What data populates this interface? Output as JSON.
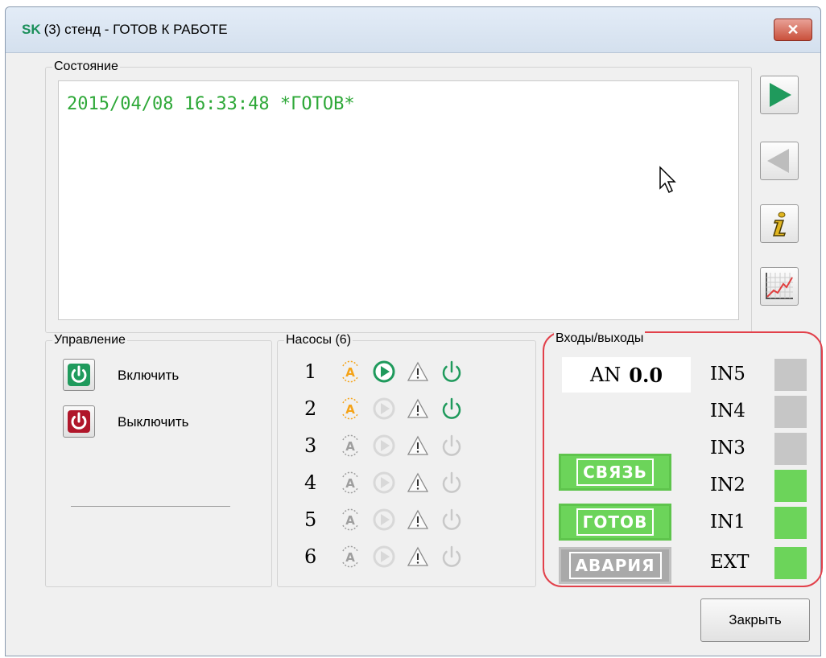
{
  "window": {
    "brand": "SK",
    "title": "(3) стенд - ГОТОВ К РАБОТЕ",
    "close_glyph": "✕"
  },
  "status": {
    "legend": "Состояние",
    "text": "2015/04/08 16:33:48 *ГОТОВ*",
    "color": "#2ea838"
  },
  "side_buttons": [
    {
      "icon": "play-right-icon"
    },
    {
      "icon": "play-left-icon",
      "enabled": false
    },
    {
      "icon": "info-icon"
    },
    {
      "icon": "chart-icon"
    }
  ],
  "control": {
    "legend": "Управление",
    "on_label": "Включить",
    "off_label": "Выключить"
  },
  "pumps": {
    "legend": "Насосы (6)",
    "items": [
      {
        "num": "1",
        "auto": true,
        "run": true,
        "alarm": false,
        "power": true
      },
      {
        "num": "2",
        "auto": true,
        "run": false,
        "alarm": false,
        "power": true
      },
      {
        "num": "3",
        "auto": false,
        "run": false,
        "alarm": false,
        "power": false
      },
      {
        "num": "4",
        "auto": false,
        "run": false,
        "alarm": false,
        "power": false
      },
      {
        "num": "5",
        "auto": false,
        "run": false,
        "alarm": false,
        "power": false
      },
      {
        "num": "6",
        "auto": false,
        "run": false,
        "alarm": false,
        "power": false
      }
    ]
  },
  "io": {
    "legend": "Входы/выходы",
    "an_label": "AN",
    "an_value": "0.0",
    "badges": [
      {
        "label": "СВЯЗЬ",
        "active": true
      },
      {
        "label": "ГОТОВ",
        "active": true
      },
      {
        "label": "АВАРИЯ",
        "active": false
      }
    ],
    "inputs": [
      {
        "label": "IN5",
        "on": false
      },
      {
        "label": "IN4",
        "on": false
      },
      {
        "label": "IN3",
        "on": false
      },
      {
        "label": "IN2",
        "on": true
      },
      {
        "label": "IN1",
        "on": true
      },
      {
        "label": "EXT",
        "on": true
      }
    ],
    "colors": {
      "on": "#6cd45a",
      "off": "#c6c6c6",
      "frame": "#e2404a"
    }
  },
  "footer": {
    "close_label": "Закрыть"
  }
}
